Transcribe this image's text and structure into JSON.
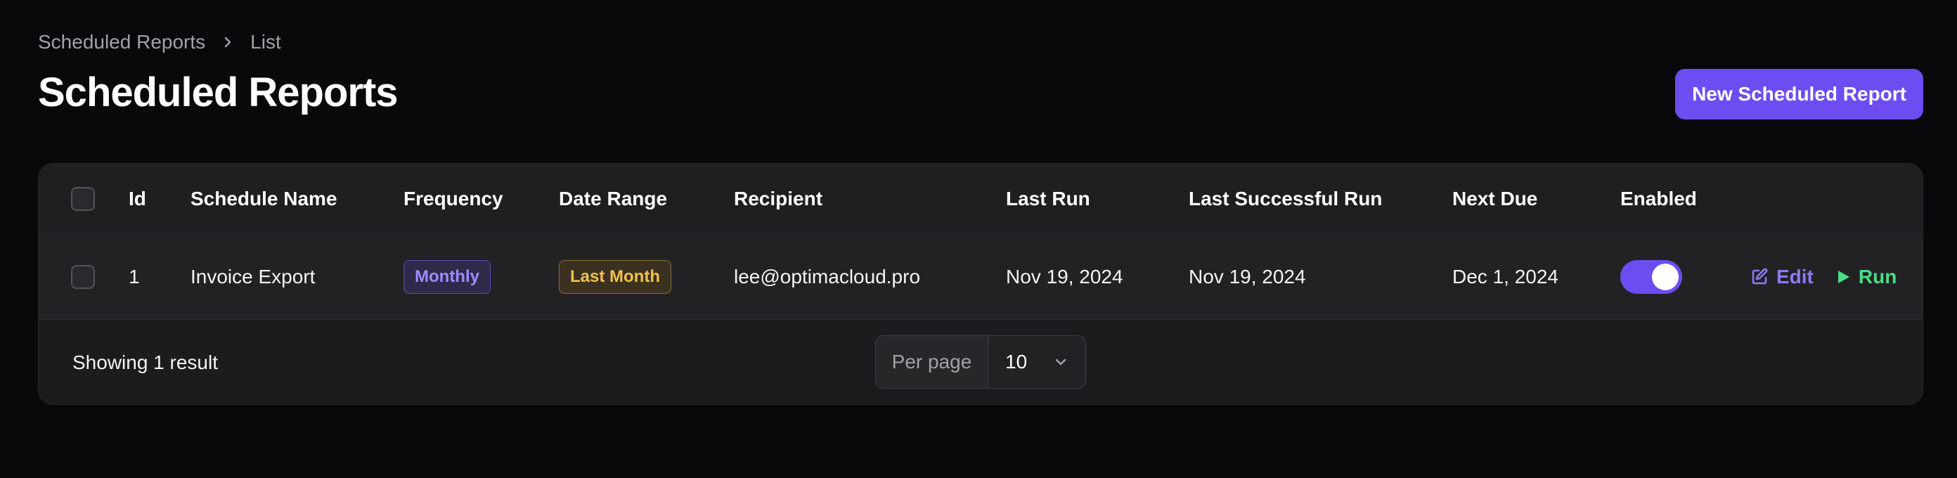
{
  "breadcrumb": {
    "items": [
      "Scheduled Reports",
      "List"
    ]
  },
  "page": {
    "title": "Scheduled Reports"
  },
  "actions": {
    "new_report_label": "New Scheduled Report"
  },
  "table": {
    "columns": [
      "Id",
      "Schedule Name",
      "Frequency",
      "Date Range",
      "Recipient",
      "Last Run",
      "Last Successful Run",
      "Next Due",
      "Enabled"
    ],
    "rows": [
      {
        "id": "1",
        "name": "Invoice Export",
        "frequency": "Monthly",
        "date_range": "Last Month",
        "recipient": "lee@optimacloud.pro",
        "last_run": "Nov 19, 2024",
        "last_successful_run": "Nov 19, 2024",
        "next_due": "Dec 1, 2024",
        "enabled": true,
        "edit_label": "Edit",
        "run_label": "Run"
      }
    ]
  },
  "footer": {
    "summary": "Showing 1 result",
    "per_page_label": "Per page",
    "per_page_value": "10"
  },
  "colors": {
    "background": "#09090b",
    "primary": "#6d4df2",
    "edit_action": "#8b7bf6",
    "run_action": "#4ade80",
    "badge_monthly": "#9b8cff",
    "badge_last_month": "#f2c14e"
  },
  "icons": {
    "breadcrumb_separator": "chevron-right-icon",
    "edit": "edit-icon",
    "run": "play-icon",
    "per_page_dropdown": "chevron-down-icon"
  }
}
